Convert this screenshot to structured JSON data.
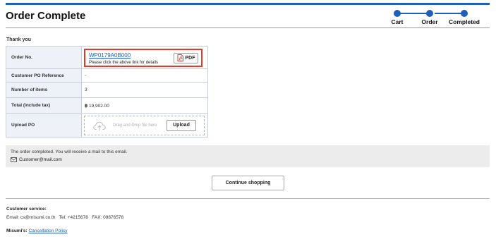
{
  "page": {
    "title": "Order Complete"
  },
  "steps": [
    {
      "label": "Cart"
    },
    {
      "label": "Order"
    },
    {
      "label": "Completed"
    }
  ],
  "colors": {
    "accent": "#1f5fb8",
    "highlight_border": "#e03a2f"
  },
  "thank_you": "Thank you",
  "order_table": {
    "order_no_label": "Order No.",
    "order_no_value": "WP0179A0B000",
    "order_no_hint": "Please click the above link for details",
    "pdf_label": "PDF",
    "customer_po_label": "Customer PO Reference",
    "customer_po_value": "-",
    "items_label": "Number of items",
    "items_value": "3",
    "total_label": "Total (include tax)",
    "total_currency": "฿",
    "total_value": "19,902.00",
    "upload_label": "Upload PO",
    "drop_placeholder": "Drag and Drop file here",
    "upload_button": "Upload"
  },
  "notice": {
    "message": "The order completed. You will receive a mail to this email.",
    "email": "Customer@mail.com"
  },
  "continue_button": "Continue shopping",
  "footer": {
    "cs_title": "Customer service:",
    "email_label": "Email:",
    "email_value": "cs@misumi.co.th",
    "tel_label": "Tel:",
    "tel_value": "+4215678",
    "fax_label": "FAX:",
    "fax_value": "09876578",
    "policy_label": "Misumi's:",
    "policy_link": "Cancellation Policy"
  },
  "icons": {
    "pdf": "pdf-icon",
    "upload": "cloud-upload-icon",
    "mail": "mail-icon"
  }
}
